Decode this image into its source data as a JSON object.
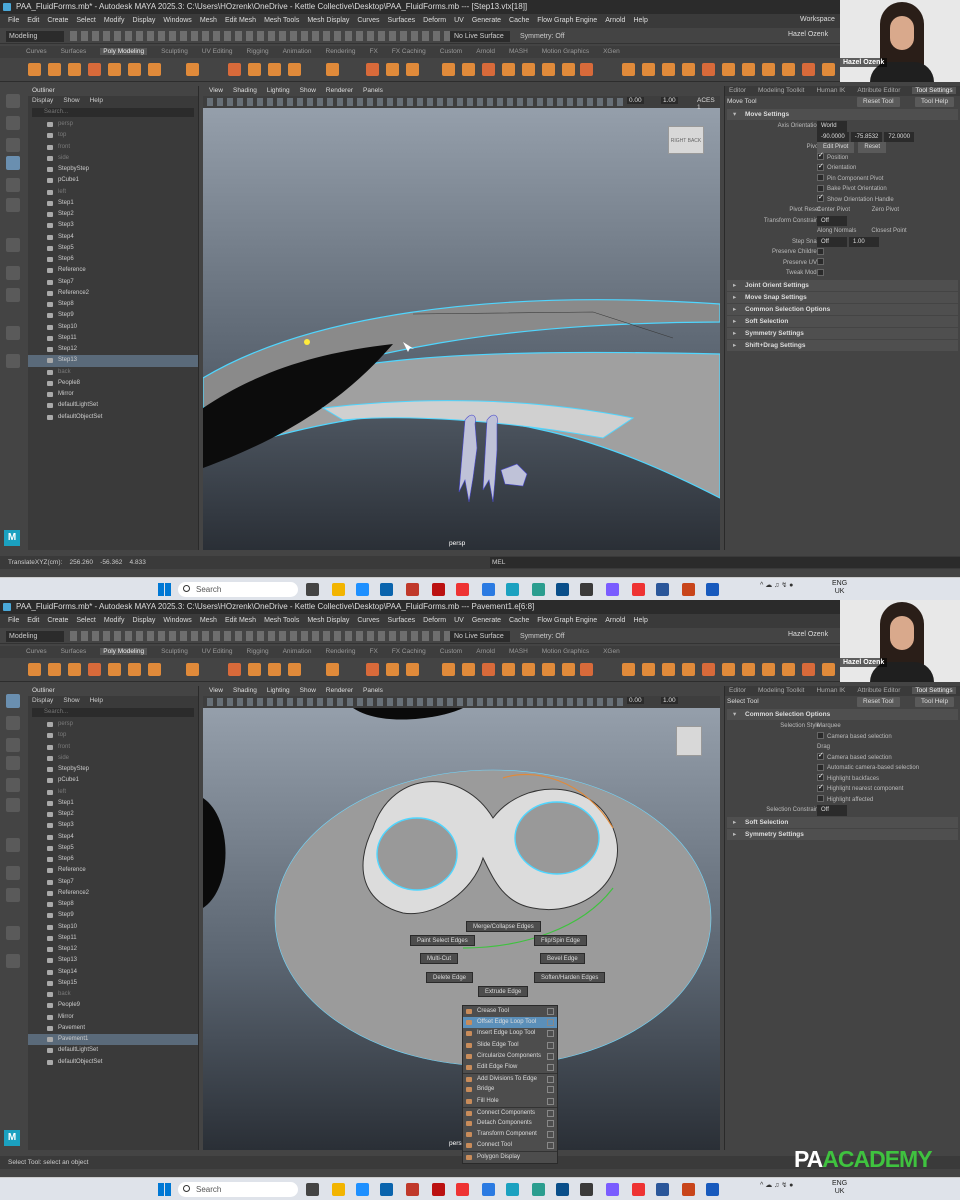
{
  "screens": [
    {
      "title": "PAA_FluidForms.mb* - Autodesk MAYA 2025.3: C:\\Users\\HOzrenk\\OneDrive - Kettle Collective\\Desktop\\PAA_FluidForms.mb  ---  [Step13.vtx[18]]",
      "menus": [
        "File",
        "Edit",
        "Create",
        "Select",
        "Modify",
        "Display",
        "Windows",
        "Mesh",
        "Edit Mesh",
        "Mesh Tools",
        "Mesh Display",
        "Curves",
        "Surfaces",
        "Deform",
        "UV",
        "Generate",
        "Cache",
        "Flow Graph Engine",
        "Arnold",
        "Help"
      ],
      "workspace": "Workspace",
      "mode": "Modeling",
      "live_surface": "No Live Surface",
      "symmetry": "Symmetry: Off",
      "user": "Hazel Ozenk",
      "shelf_tabs": [
        "Curves",
        "Surfaces",
        "Poly Modeling",
        "Sculpting",
        "UV Editing",
        "Rigging",
        "Animation",
        "Rendering",
        "FX",
        "FX Caching",
        "Custom",
        "Arnold",
        "MASH",
        "Motion Graphics",
        "XGen"
      ],
      "outliner": {
        "title": "Outliner",
        "menu": [
          "Display",
          "Show",
          "Help"
        ],
        "search": "Search...",
        "items": [
          {
            "t": "persp",
            "d": true
          },
          {
            "t": "top",
            "d": true
          },
          {
            "t": "front",
            "d": true
          },
          {
            "t": "side",
            "d": true
          },
          {
            "t": "StepbyStep"
          },
          {
            "t": "pCube1"
          },
          {
            "t": "left",
            "d": true
          },
          {
            "t": "Step1"
          },
          {
            "t": "Step2"
          },
          {
            "t": "Step3"
          },
          {
            "t": "Step4"
          },
          {
            "t": "Step5"
          },
          {
            "t": "Step6"
          },
          {
            "t": "Reference"
          },
          {
            "t": "Step7"
          },
          {
            "t": "Reference2"
          },
          {
            "t": "Step8"
          },
          {
            "t": "Step9"
          },
          {
            "t": "Step10"
          },
          {
            "t": "Step11"
          },
          {
            "t": "Step12"
          },
          {
            "t": "Step13",
            "s": true
          },
          {
            "t": "back",
            "d": true
          },
          {
            "t": "People8"
          },
          {
            "t": "Mirror"
          },
          {
            "t": "defaultLightSet"
          },
          {
            "t": "defaultObjectSet"
          }
        ]
      },
      "viewport": {
        "menu": [
          "View",
          "Shading",
          "Lighting",
          "Show",
          "Renderer",
          "Panels"
        ],
        "v1": "0.00",
        "v2": "1.00",
        "cs": "ACES 1",
        "camera": "persp",
        "cube_a": "RIGHT",
        "cube_b": "BACK"
      },
      "attr": {
        "tabs": [
          "Editor",
          "Modeling Toolkit",
          "Human IK",
          "Attribute Editor",
          "Tool Settings"
        ],
        "tool": "Move Tool",
        "reset": "Reset Tool",
        "help": "Tool Help",
        "sections": [
          "Move Settings",
          "Joint Orient Settings",
          "Move Snap Settings",
          "Common Selection Options",
          "Soft Selection",
          "Symmetry Settings",
          "Shift+Drag Settings"
        ],
        "axis_orientation": "Axis Orientation",
        "world": "World",
        "f1": "-90.0000",
        "f2": "-75.8532",
        "f3": "72.0000",
        "pivot": "Pivot",
        "edit_pivot": "Edit Pivot",
        "reset_btn": "Reset",
        "checks": [
          "Position",
          "Orientation",
          "Pin Component Pivot",
          "Bake Pivot Orientation",
          "Show Orientation Handle"
        ],
        "pivot_reset": "Pivot Reset",
        "center_pivot": "Center Pivot",
        "zero_pivot": "Zero Pivot",
        "transform_constraint": "Transform Constraint",
        "off": "Off",
        "along_normals": "Along Normals",
        "closest_point": "Closest Point",
        "step_snap": "Step Snap",
        "step_val": "1.00",
        "preserve_children": "Preserve Children",
        "preserve_uvs": "Preserve UVs",
        "tweak_mode": "Tweak Mode"
      },
      "status": {
        "label": "TranslateXYZ(cm):",
        "x": "256.260",
        "y": "-56.362",
        "z": "4.833",
        "mel": "MEL"
      },
      "taskbar": {
        "search": "Search",
        "lang1": "ENG",
        "lang2": "UK"
      }
    },
    {
      "title": "PAA_FluidForms.mb* - Autodesk MAYA 2025.3: C:\\Users\\HOzrenk\\OneDrive - Kettle Collective\\Desktop\\PAA_FluidForms.mb  ---  Pavement1.e[6:8]",
      "outliner_items": [
        {
          "t": "persp",
          "d": true
        },
        {
          "t": "top",
          "d": true
        },
        {
          "t": "front",
          "d": true
        },
        {
          "t": "side",
          "d": true
        },
        {
          "t": "StepbyStep"
        },
        {
          "t": "pCube1"
        },
        {
          "t": "left",
          "d": true
        },
        {
          "t": "Step1"
        },
        {
          "t": "Step2"
        },
        {
          "t": "Step3"
        },
        {
          "t": "Step4"
        },
        {
          "t": "Step5"
        },
        {
          "t": "Step6"
        },
        {
          "t": "Reference"
        },
        {
          "t": "Step7"
        },
        {
          "t": "Reference2"
        },
        {
          "t": "Step8"
        },
        {
          "t": "Step9"
        },
        {
          "t": "Step10"
        },
        {
          "t": "Step11"
        },
        {
          "t": "Step12"
        },
        {
          "t": "Step13"
        },
        {
          "t": "Step14"
        },
        {
          "t": "Step15"
        },
        {
          "t": "back",
          "d": true
        },
        {
          "t": "People9"
        },
        {
          "t": "Mirror"
        },
        {
          "t": "Pavement"
        },
        {
          "t": "Pavement1",
          "s": true
        },
        {
          "t": "defaultLightSet"
        },
        {
          "t": "defaultObjectSet"
        }
      ],
      "attr": {
        "tool": "Select Tool",
        "sections": [
          "Common Selection Options",
          "Soft Selection",
          "Symmetry Settings"
        ],
        "selection_style": "Selection Style",
        "marquee": "Marquee",
        "camera_based": "Camera based selection",
        "drag": "Drag",
        "camera_based2": "Camera based selection",
        "auto_cam": "Automatic camera-based selection",
        "hl_backfaces": "Highlight backfaces",
        "hl_nearest": "Highlight nearest component",
        "hl_affected": "Highlight affected",
        "selection_constraint": "Selection Constraint",
        "off": "Off"
      },
      "marking_menu": {
        "top": "Merge/Collapse Edges",
        "l1": "Paint Select Edges",
        "r1": "Flip/Spin Edge",
        "l2": "Multi-Cut",
        "r2": "Bevel Edge",
        "l3": "Delete Edge",
        "r3": "Soften/Harden Edges",
        "bottom": "Extrude Edge"
      },
      "popup": [
        "Crease Tool",
        "Offset Edge Loop Tool",
        "Insert Edge Loop Tool",
        "Slide Edge Tool",
        "Circularize Components",
        "Edit Edge Flow",
        "Add Divisions To Edge",
        "Bridge",
        "Fill Hole",
        "Connect Components",
        "Detach Components",
        "Transform Component",
        "Connect Tool",
        "Polygon Display"
      ],
      "status": "Select Tool: select an object",
      "brand_a": "PA",
      "brand_b": "ACADEMY"
    }
  ],
  "colors": {
    "accent": "#5b8fb9",
    "icon": "#e08a3a",
    "cyan": "#4fd6ff",
    "green": "#3fc23f"
  }
}
